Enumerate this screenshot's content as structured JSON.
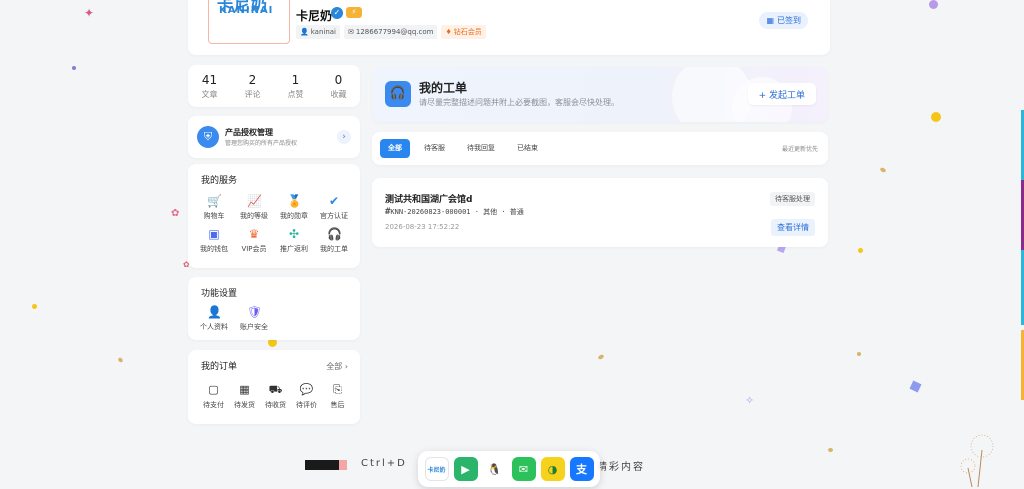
{
  "profile": {
    "logo_cn": "卡尼奶",
    "logo_en": "KANINAI",
    "username": "卡尼奶",
    "verify_mark": "✓",
    "level_mark": "⚡",
    "handle": "kaninai",
    "email": "1286677994@qq.com",
    "vip_label": "钻石会员",
    "signed_label": "已签到"
  },
  "stats": [
    {
      "num": "41",
      "label": "文章"
    },
    {
      "num": "2",
      "label": "评论"
    },
    {
      "num": "1",
      "label": "点赞"
    },
    {
      "num": "0",
      "label": "收藏"
    }
  ],
  "auth": {
    "title": "产品授权管理",
    "subtitle": "管理您购买的所有产品授权",
    "arrow": "›"
  },
  "services": {
    "title": "我的服务",
    "items": [
      {
        "label": "购物车",
        "icon": "🛒",
        "color": "#f26b3a"
      },
      {
        "label": "我的等级",
        "icon": "📈",
        "color": "#4a6cf0"
      },
      {
        "label": "我的勋章",
        "icon": "🏅",
        "color": "#f5a623"
      },
      {
        "label": "官方认证",
        "icon": "✔",
        "color": "#2a86ef"
      },
      {
        "label": "我的钱包",
        "icon": "▣",
        "color": "#4a6cf0"
      },
      {
        "label": "VIP会员",
        "icon": "♛",
        "color": "#f26b3a"
      },
      {
        "label": "推广返利",
        "icon": "✣",
        "color": "#22b5a0"
      },
      {
        "label": "我的工单",
        "icon": "🎧",
        "color": "#333333"
      }
    ]
  },
  "settings": {
    "title": "功能设置",
    "items": [
      {
        "label": "个人资料",
        "icon": "👤",
        "color": "#2a86ef"
      },
      {
        "label": "账户安全",
        "icon": "🛡",
        "color": "#6a5cf0"
      }
    ]
  },
  "orders": {
    "title": "我的订单",
    "all_label": "全部 ›",
    "items": [
      {
        "label": "待支付",
        "icon": "▢"
      },
      {
        "label": "待发货",
        "icon": "▦"
      },
      {
        "label": "待收货",
        "icon": "⛟"
      },
      {
        "label": "待评价",
        "icon": "💬"
      },
      {
        "label": "售后",
        "icon": "⎘"
      }
    ]
  },
  "ticket_header": {
    "title": "我的工单",
    "subtitle": "请尽量完整描述问题并附上必要截图，客服会尽快处理。",
    "new_button": "+ 发起工单",
    "icon": "🎧"
  },
  "filter": {
    "tabs": [
      "全部",
      "待客服",
      "待我回复",
      "已结束"
    ],
    "active_tab": 0,
    "sort_label": "最近更新优先"
  },
  "tickets": [
    {
      "title": "测试共和国湖广会馆d",
      "hash": "#",
      "number": "KNN-20260823-000001 · 其他 · 普通",
      "time": "2026-08-23 17:52:22",
      "status": "待客服处理",
      "detail_button": "查看详情"
    }
  ],
  "bottom": {
    "hint_left": "Ctrl+D",
    "hint_right": "精彩内容",
    "dock_apps": [
      {
        "label": "卡尼奶",
        "color": "#ffffff",
        "text_color": "#2a86d8",
        "icon": "logo-icon"
      },
      {
        "label": "▶",
        "color": "#2bb56a",
        "text_color": "#ffffff",
        "icon": "play-store-icon"
      },
      {
        "label": "🐧",
        "color": "#ffffff",
        "text_color": "#111111",
        "icon": "qq-icon"
      },
      {
        "label": "✉",
        "color": "#2dc15b",
        "text_color": "#ffffff",
        "icon": "wechat-icon"
      },
      {
        "label": "◑",
        "color": "#f7d21c",
        "text_color": "#1a7d3c",
        "icon": "moments-icon"
      },
      {
        "label": "支",
        "color": "#1677ff",
        "text_color": "#ffffff",
        "icon": "alipay-icon"
      }
    ]
  }
}
